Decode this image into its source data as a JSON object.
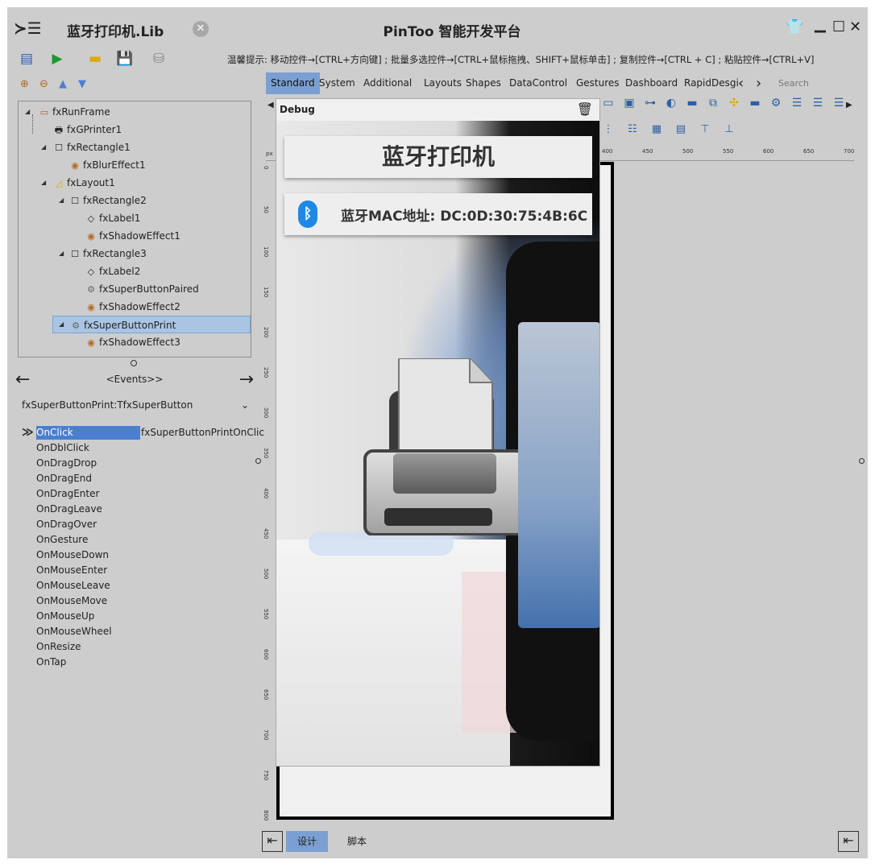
{
  "window": {
    "menu_icon": "menu-icon",
    "doc_title": "蓝牙打印机.Lib",
    "doc_close_glyph": "✕",
    "app_title": "PinToo 智能开发平台",
    "controls": [
      "👕",
      "▁",
      "☐",
      "✕"
    ]
  },
  "toolbar": {
    "buttons": [
      "new-project-icon",
      "run-icon",
      "open-folder-icon",
      "save-icon",
      "database-icon"
    ],
    "hint": "温馨提示: 移动控件→[CTRL+方向键] ; 批量多选控件→[CTRL+鼠标拖拽、SHIFT+鼠标单击] ; 复制控件→[CTRL + C] ; 粘贴控件→[CTRL+V]"
  },
  "tree": {
    "nodes": [
      {
        "label": "fxRunFrame",
        "icon": "frame-icon"
      },
      {
        "label": "fxGPrinter1",
        "icon": "printer-icon"
      },
      {
        "label": "fxRectangle1",
        "icon": "rectangle-icon"
      },
      {
        "label": "fxBlurEffect1",
        "icon": "effect-icon"
      },
      {
        "label": "fxLayout1",
        "icon": "layout-icon"
      },
      {
        "label": "fxRectangle2",
        "icon": "rectangle-icon"
      },
      {
        "label": "fxLabel1",
        "icon": "label-icon"
      },
      {
        "label": "fxShadowEffect1",
        "icon": "effect-icon"
      },
      {
        "label": "fxRectangle3",
        "icon": "rectangle-icon"
      },
      {
        "label": "fxLabel2",
        "icon": "label-icon"
      },
      {
        "label": "fxSuperButtonPaired",
        "icon": "superbutton-icon"
      },
      {
        "label": "fxShadowEffect2",
        "icon": "effect-icon"
      },
      {
        "label": "fxSuperButtonPrint",
        "icon": "superbutton-icon"
      },
      {
        "label": "fxShadowEffect3",
        "icon": "effect-icon"
      }
    ],
    "selected": "fxSuperButtonPrint"
  },
  "events": {
    "nav_label": "<Events>>",
    "component": "fxSuperButtonPrint:TfxSuperButton",
    "marker": "≫",
    "list": [
      "OnClick",
      "OnDblClick",
      "OnDragDrop",
      "OnDragEnd",
      "OnDragEnter",
      "OnDragLeave",
      "OnDragOver",
      "OnGesture",
      "OnMouseDown",
      "OnMouseEnter",
      "OnMouseLeave",
      "OnMouseMove",
      "OnMouseUp",
      "OnMouseWheel",
      "OnResize",
      "OnTap"
    ],
    "onclick_handler": "fxSuperButtonPrintOnClic"
  },
  "palette": {
    "tabs": [
      "Standard",
      "System",
      "Additional",
      "Layouts",
      "Shapes",
      "DataControl",
      "Gestures",
      "Dashboard",
      "RapidDesgi"
    ],
    "active": "Standard",
    "search_placeholder": "Search"
  },
  "ruler": {
    "unit": "px",
    "top_ticks": [
      "400",
      "450",
      "500",
      "550",
      "600",
      "650",
      "700"
    ],
    "left_ticks": [
      "0",
      "50",
      "100",
      "150",
      "200",
      "250",
      "300",
      "350",
      "400",
      "450",
      "500",
      "550",
      "600",
      "650",
      "700",
      "750",
      "800"
    ]
  },
  "debug": {
    "title": "Debug",
    "app_heading": "蓝牙打印机",
    "mac_label": "蓝牙MAC地址: DC:0D:30:75:4B:6C"
  },
  "bottom": {
    "tabs": [
      "设计",
      "脚本"
    ],
    "active": "设计"
  },
  "colors": {
    "selection": "#a9c5e3",
    "active_tab": "#7a9fd3",
    "event_highlight": "#4a7fd0",
    "bluetooth": "#1e88e5"
  }
}
